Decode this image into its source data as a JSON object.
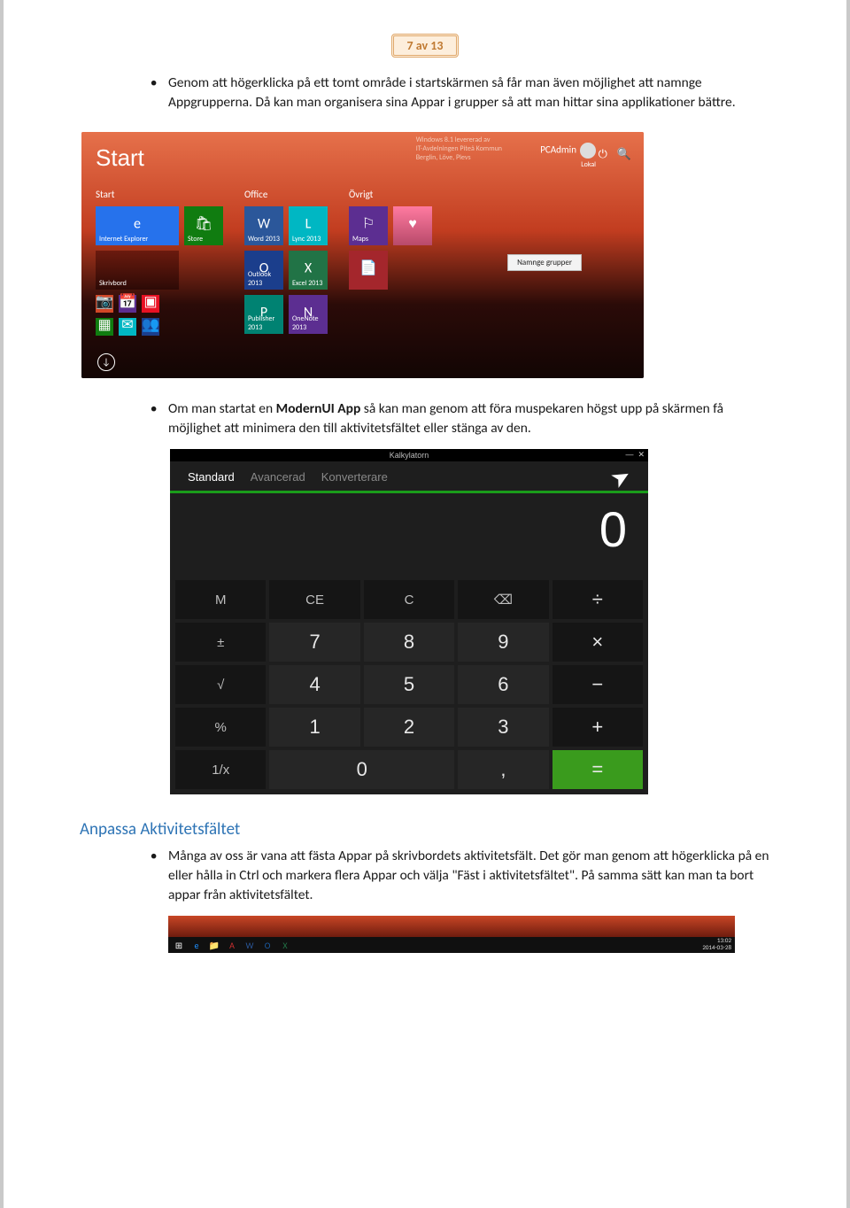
{
  "page_number": "7 av 13",
  "para1": "Genom att högerklicka på ett tomt område i startskärmen så får man även möjlighet att namnge Appgrupperna. Då kan man organisera sina Appar i grupper så att man hittar sina applikationer bättre.",
  "para2_pre": "Om man startat en ",
  "para2_bold": "ModernUI App",
  "para2_post": " så kan man genom att föra muspekaren högst upp på skärmen få möjlighet att minimera den till aktivitetsfältet eller stänga av den.",
  "section_heading": "Anpassa Aktivitetsfältet",
  "para3": "Många av oss är vana att fästa Appar på skrivbordets aktivitetsfält. Det gör man genom att högerklicka på en eller hålla in Ctrl och markera flera Appar och välja \"Fäst i aktivitetsfältet\". På samma sätt kan man ta bort appar från aktivitetsfältet.",
  "start": {
    "title": "Start",
    "user_name": "PCAdmin",
    "user_loc": "Lokal",
    "small1": "Windows 8.1 levererad av",
    "small2": "IT-Avdelningen Piteå Kommun",
    "small3": "Berglin, Löve, Plevs",
    "context_menu": "Namnge grupper",
    "groups": [
      {
        "label": "Start",
        "tiles": [
          [
            {
              "name": "Internet Explorer",
              "cls": "t-blue wide",
              "ic": "e"
            },
            {
              "name": "Store",
              "cls": "t-green sq",
              "ic": "🛍"
            }
          ],
          [
            {
              "name": "Skrivbord",
              "cls": "t-img wide",
              "ic": ""
            }
          ],
          [
            {
              "name": "",
              "cls": "t-orange sm",
              "ic": "📷"
            },
            {
              "name": "",
              "cls": "t-violet sm",
              "ic": "📅"
            },
            {
              "name": "",
              "cls": "t-red sm",
              "ic": "▣"
            }
          ],
          [
            {
              "name": "",
              "cls": "t-green sm",
              "ic": "▦"
            },
            {
              "name": "",
              "cls": "t-cyan sm",
              "ic": "✉"
            },
            {
              "name": "",
              "cls": "t-dblue sm",
              "ic": "👥"
            }
          ]
        ]
      },
      {
        "label": "Office",
        "tiles": [
          [
            {
              "name": "Word 2013",
              "cls": "t-oblue sq",
              "ic": "W"
            },
            {
              "name": "Lync 2013",
              "cls": "t-cyan sq",
              "ic": "L"
            }
          ],
          [
            {
              "name": "Outlook 2013",
              "cls": "t-dblue sq",
              "ic": "O"
            },
            {
              "name": "Excel 2013",
              "cls": "t-xgreen sq",
              "ic": "X"
            }
          ],
          [
            {
              "name": "Publisher 2013",
              "cls": "t-teal sq",
              "ic": "P"
            },
            {
              "name": "OneNote 2013",
              "cls": "t-violet sq",
              "ic": "N"
            }
          ]
        ]
      },
      {
        "label": "Övrigt",
        "tiles": [
          [
            {
              "name": "Maps",
              "cls": "t-violet sq",
              "ic": "⚐"
            },
            {
              "name": "",
              "cls": "t-photo sq",
              "ic": "♥"
            }
          ],
          [
            {
              "name": "",
              "cls": "t-maroon sq",
              "ic": "📄"
            }
          ]
        ]
      }
    ]
  },
  "calc": {
    "title": "Kalkylatorn",
    "tabs": [
      "Standard",
      "Avancerad",
      "Konverterare"
    ],
    "display": "0",
    "keys": [
      {
        "l": "M",
        "c": "func"
      },
      {
        "l": "CE",
        "c": "func"
      },
      {
        "l": "C",
        "c": "func"
      },
      {
        "l": "⌫",
        "c": "func"
      },
      {
        "l": "÷",
        "c": "op"
      },
      {
        "l": "±",
        "c": "func"
      },
      {
        "l": "7",
        "c": "dark"
      },
      {
        "l": "8",
        "c": "dark"
      },
      {
        "l": "9",
        "c": "dark"
      },
      {
        "l": "×",
        "c": "op"
      },
      {
        "l": "√",
        "c": "func"
      },
      {
        "l": "4",
        "c": "dark"
      },
      {
        "l": "5",
        "c": "dark"
      },
      {
        "l": "6",
        "c": "dark"
      },
      {
        "l": "−",
        "c": "op"
      },
      {
        "l": "%",
        "c": "func"
      },
      {
        "l": "1",
        "c": "dark"
      },
      {
        "l": "2",
        "c": "dark"
      },
      {
        "l": "3",
        "c": "dark"
      },
      {
        "l": "+",
        "c": "op"
      },
      {
        "l": "1/x",
        "c": "func"
      },
      {
        "l": "0",
        "c": "dark zero"
      },
      {
        "l": ",",
        "c": "dark"
      },
      {
        "l": "=",
        "c": "eq"
      }
    ]
  },
  "taskbar": {
    "time": "13:02",
    "date": "2014-03-28",
    "icons": [
      "⊞",
      "e",
      "📁",
      "A",
      "W",
      "O",
      "X"
    ]
  }
}
